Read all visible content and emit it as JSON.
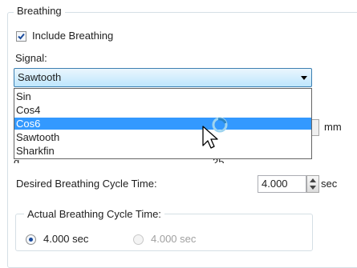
{
  "breathing_group": {
    "title": "Breathing"
  },
  "include_breathing": {
    "label": "Include Breathing",
    "checked": true
  },
  "signal": {
    "label": "Signal:",
    "selected": "Sawtooth",
    "options": [
      "Sin",
      "Cos4",
      "Cos6",
      "Sawtooth",
      "Sharkfin"
    ],
    "highlighted_option": "Cos6"
  },
  "obscured_row": {
    "unit": "mm",
    "label_fragment": "g",
    "value_fragment": "25"
  },
  "desired_cycle": {
    "label": "Desired Breathing Cycle Time:",
    "value": "4.000",
    "unit": "sec"
  },
  "actual_cycle": {
    "title": "Actual Breathing Cycle Time:",
    "option1_label": "4.000 sec",
    "option2_label": "4.000 sec"
  },
  "colors": {
    "highlight": "#3399ff",
    "combo_border": "#3c7fb1",
    "group_border": "#d5dfe5"
  },
  "cursor": {
    "icon": "busy-arrow-cursor-icon"
  }
}
